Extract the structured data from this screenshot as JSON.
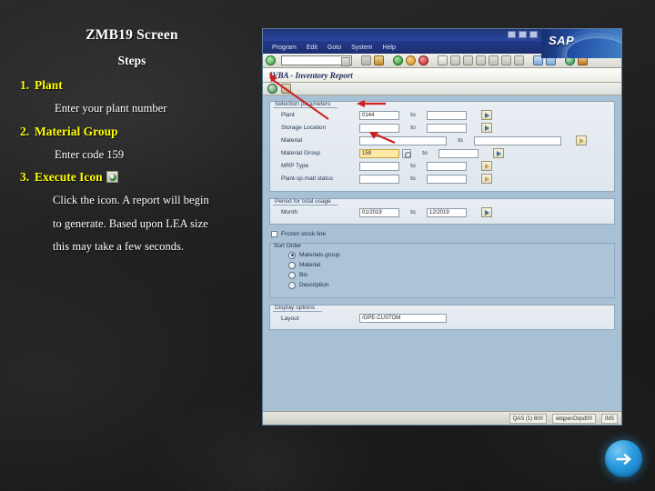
{
  "slide": {
    "title": "ZMB19 Screen",
    "subtitle": "Steps",
    "steps": [
      {
        "num": "1.",
        "head": "Plant",
        "body": [
          "Enter your plant number"
        ]
      },
      {
        "num": "2.",
        "head": "Material Group",
        "body": [
          "Enter code 159"
        ]
      },
      {
        "num": "3.",
        "head": "Execute Icon",
        "body": [
          "Click the icon.  A report will begin",
          "to generate.  Based upon LEA size",
          "this may take a few seconds."
        ]
      }
    ],
    "next_button_glyph": "→"
  },
  "sap": {
    "logo_text": "SAP",
    "menus": [
      "Program",
      "Edit",
      "Goto",
      "System",
      "Help"
    ],
    "command_field_value": "",
    "screen_title": "IVBA - Inventory Report",
    "selection": {
      "legend": "Selection parameters",
      "to_label": "to",
      "rows": [
        {
          "label": "Plant",
          "value": "0144",
          "to_value": "",
          "highlight": false
        },
        {
          "label": "Storage Location",
          "value": "",
          "to_value": "",
          "highlight": false
        },
        {
          "label": "Material",
          "value": "",
          "to_value": "",
          "highlight": false,
          "wide": true
        },
        {
          "label": "Material Group",
          "value": "159",
          "to_value": "",
          "highlight": true
        },
        {
          "label": "MRP Type",
          "value": "",
          "to_value": "",
          "highlight": false
        },
        {
          "label": "Plant-sp.matl status",
          "value": "",
          "to_value": "",
          "highlight": false
        }
      ]
    },
    "period": {
      "legend": "Period for total usage",
      "label": "Month",
      "from": "01/2019",
      "to_label": "to",
      "to": "12/2019"
    },
    "frozen_checkbox_label": "Frozen stock line",
    "sort": {
      "legend": "Sort Order",
      "options": [
        {
          "label": "Materials group",
          "selected": true
        },
        {
          "label": "Material",
          "selected": false
        },
        {
          "label": "Bin",
          "selected": false
        },
        {
          "label": "Description",
          "selected": false
        }
      ]
    },
    "display": {
      "legend": "Display options",
      "layout_label": "Layout",
      "layout_value": "/OPE-CUSTOM"
    },
    "statusbar": {
      "system": "QAS (1) 600",
      "server": "wtqpecOqsd00",
      "mode": "INS"
    }
  },
  "annotations": [
    {
      "id": "1",
      "label": "1"
    },
    {
      "id": "2",
      "label": "2"
    },
    {
      "id": "3",
      "label": "3"
    }
  ],
  "colors": {
    "accent_yellow": "#ffff00",
    "annotation_red": "#cc1f1f",
    "sap_blue": "#2450a8",
    "next_blue": "#2b9ce0"
  }
}
